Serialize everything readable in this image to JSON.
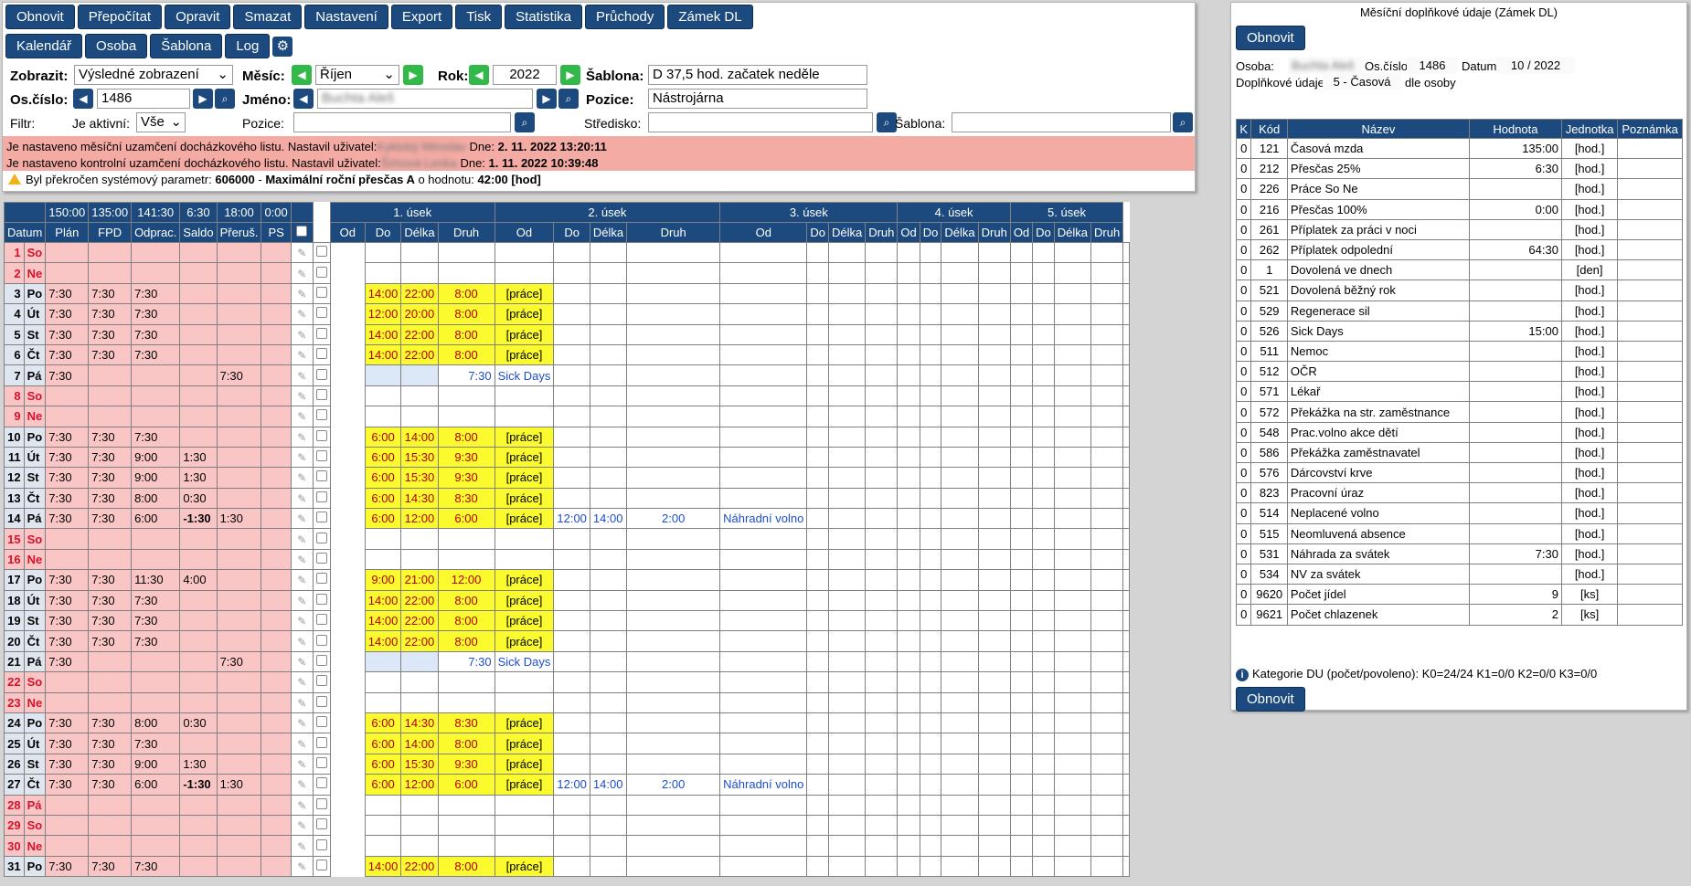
{
  "toolbar_row1": [
    "Obnovit",
    "Přepočítat",
    "Opravit",
    "Smazat",
    "Nastavení",
    "Export",
    "Tisk",
    "Statistika",
    "Průchody",
    "Zámek DL"
  ],
  "toolbar_row2": [
    "Kalendář",
    "Osoba",
    "Šablona",
    "Log"
  ],
  "filters": {
    "zobrazit_label": "Zobrazit:",
    "zobrazit_value": "Výsledné zobrazení",
    "mesic_label": "Měsíc:",
    "mesic_value": "Říjen",
    "rok_label": "Rok:",
    "rok_value": "2022",
    "sablona_label": "Šablona:",
    "sablona_value": "D 37,5 hod. začatek neděle",
    "oscislo_label": "Os.číslo:",
    "oscislo_value": "1486",
    "jmeno_label": "Jméno:",
    "jmeno_value": "Buchta Aleš",
    "pozice_label": "Pozice:",
    "pozice_value": "Nástrojárna",
    "filtr_label": "Filtr:",
    "aktivni_label": "Je aktivní:",
    "aktivni_value": "Vše",
    "pozice2_label": "Pozice:",
    "stredisko_label": "Středisko:",
    "sablona2_label": "Šablona:"
  },
  "messages": {
    "m1_a": "Je nastaveno měsíční uzamčení docházkového listu. Nastavil uživatel:",
    "m1_user": "Kyklobý Miroslav",
    "m1_b": " Dne: ",
    "m1_date": "2. 11. 2022 13:20:11",
    "m2_a": "Je nastaveno kontrolní uzamčení docházkového listu. Nastavil uživatel:",
    "m2_user": "Šímová Lenka",
    "m2_b": " Dne: ",
    "m2_date": "1. 11. 2022 10:39:48",
    "w_a": "Byl překročen systémový parametr: ",
    "w_code": "606000",
    "w_b": " - ",
    "w_name": "Maximální roční přesčas A",
    "w_c": " o hodnotu: ",
    "w_val": "42:00 [hod]"
  },
  "grid": {
    "totals": [
      "150:00",
      "135:00",
      "141:30",
      "6:30",
      "18:00",
      "0:00"
    ],
    "sections": [
      "1. úsek",
      "2. úsek",
      "3. úsek",
      "4. úsek",
      "5. úsek"
    ],
    "cols": [
      "Datum",
      "Plán",
      "FPD",
      "Odprac.",
      "Saldo",
      "Přeruš.",
      "PS"
    ],
    "sub": [
      "Od",
      "Do",
      "Délka",
      "Druh"
    ],
    "rows": [
      {
        "n": "1",
        "d": "So",
        "w": true
      },
      {
        "n": "2",
        "d": "Ne",
        "w": true,
        "sep": true
      },
      {
        "n": "3",
        "d": "Po",
        "plan": "7:30",
        "fpd": "7:30",
        "odp": "7:30",
        "od": "14:00",
        "do": "22:00",
        "del": "8:00",
        "druh": "[práce]"
      },
      {
        "n": "4",
        "d": "Út",
        "plan": "7:30",
        "fpd": "7:30",
        "odp": "7:30",
        "od": "12:00",
        "do": "20:00",
        "del": "8:00",
        "druh": "[práce]"
      },
      {
        "n": "5",
        "d": "St",
        "plan": "7:30",
        "fpd": "7:30",
        "odp": "7:30",
        "od": "14:00",
        "do": "22:00",
        "del": "8:00",
        "druh": "[práce]"
      },
      {
        "n": "6",
        "d": "Čt",
        "plan": "7:30",
        "fpd": "7:30",
        "odp": "7:30",
        "od": "14:00",
        "do": "22:00",
        "del": "8:00",
        "druh": "[práce]"
      },
      {
        "n": "7",
        "d": "Pá",
        "plan": "7:30",
        "per": "7:30",
        "sick": true,
        "del": "7:30",
        "druh": "Sick Days"
      },
      {
        "n": "8",
        "d": "So",
        "w": true
      },
      {
        "n": "9",
        "d": "Ne",
        "w": true,
        "sep": true
      },
      {
        "n": "10",
        "d": "Po",
        "plan": "7:30",
        "fpd": "7:30",
        "odp": "7:30",
        "od": "6:00",
        "do": "14:00",
        "del": "8:00",
        "druh": "[práce]"
      },
      {
        "n": "11",
        "d": "Út",
        "plan": "7:30",
        "fpd": "7:30",
        "odp": "9:00",
        "sal": "1:30",
        "od": "6:00",
        "do": "15:30",
        "del": "9:30",
        "druh": "[práce]"
      },
      {
        "n": "12",
        "d": "St",
        "plan": "7:30",
        "fpd": "7:30",
        "odp": "9:00",
        "sal": "1:30",
        "od": "6:00",
        "do": "15:30",
        "del": "9:30",
        "druh": "[práce]"
      },
      {
        "n": "13",
        "d": "Čt",
        "plan": "7:30",
        "fpd": "7:30",
        "odp": "8:00",
        "sal": "0:30",
        "od": "6:00",
        "do": "14:30",
        "del": "8:30",
        "druh": "[práce]"
      },
      {
        "n": "14",
        "d": "Pá",
        "plan": "7:30",
        "fpd": "7:30",
        "odp": "6:00",
        "sal": "-1:30",
        "per": "1:30",
        "od": "6:00",
        "do": "12:00",
        "del": "6:00",
        "druh": "[práce]",
        "od2": "12:00",
        "do2": "14:00",
        "del2": "2:00",
        "druh2": "Náhradní volno"
      },
      {
        "n": "15",
        "d": "So",
        "w": true
      },
      {
        "n": "16",
        "d": "Ne",
        "w": true,
        "sep": true
      },
      {
        "n": "17",
        "d": "Po",
        "plan": "7:30",
        "fpd": "7:30",
        "odp": "11:30",
        "sal": "4:00",
        "od": "9:00",
        "do": "21:00",
        "del": "12:00",
        "druh": "[práce]"
      },
      {
        "n": "18",
        "d": "Út",
        "plan": "7:30",
        "fpd": "7:30",
        "odp": "7:30",
        "od": "14:00",
        "do": "22:00",
        "del": "8:00",
        "druh": "[práce]"
      },
      {
        "n": "19",
        "d": "St",
        "plan": "7:30",
        "fpd": "7:30",
        "odp": "7:30",
        "od": "14:00",
        "do": "22:00",
        "del": "8:00",
        "druh": "[práce]"
      },
      {
        "n": "20",
        "d": "Čt",
        "plan": "7:30",
        "fpd": "7:30",
        "odp": "7:30",
        "od": "14:00",
        "do": "22:00",
        "del": "8:00",
        "druh": "[práce]"
      },
      {
        "n": "21",
        "d": "Pá",
        "plan": "7:30",
        "per": "7:30",
        "sick": true,
        "del": "7:30",
        "druh": "Sick Days"
      },
      {
        "n": "22",
        "d": "So",
        "w": true
      },
      {
        "n": "23",
        "d": "Ne",
        "w": true,
        "sep": true
      },
      {
        "n": "24",
        "d": "Po",
        "plan": "7:30",
        "fpd": "7:30",
        "odp": "8:00",
        "sal": "0:30",
        "od": "6:00",
        "do": "14:30",
        "del": "8:30",
        "druh": "[práce]"
      },
      {
        "n": "25",
        "d": "Út",
        "plan": "7:30",
        "fpd": "7:30",
        "odp": "7:30",
        "od": "6:00",
        "do": "14:00",
        "del": "8:00",
        "druh": "[práce]"
      },
      {
        "n": "26",
        "d": "St",
        "plan": "7:30",
        "fpd": "7:30",
        "odp": "9:00",
        "sal": "1:30",
        "od": "6:00",
        "do": "15:30",
        "del": "9:30",
        "druh": "[práce]"
      },
      {
        "n": "27",
        "d": "Čt",
        "plan": "7:30",
        "fpd": "7:30",
        "odp": "6:00",
        "sal": "-1:30",
        "per": "1:30",
        "od": "6:00",
        "do": "12:00",
        "del": "6:00",
        "druh": "[práce]",
        "od2": "12:00",
        "do2": "14:00",
        "del2": "2:00",
        "druh2": "Náhradní volno"
      },
      {
        "n": "28",
        "d": "Pá",
        "w": true
      },
      {
        "n": "29",
        "d": "So",
        "w": true
      },
      {
        "n": "30",
        "d": "Ne",
        "w": true,
        "sep": true
      },
      {
        "n": "31",
        "d": "Po",
        "plan": "7:30",
        "fpd": "7:30",
        "odp": "7:30",
        "od": "14:00",
        "do": "22:00",
        "del": "8:00",
        "druh": "[práce]"
      }
    ]
  },
  "right": {
    "title": "Měsíční doplňkové údaje (Zámek DL)",
    "obnovit": "Obnovit",
    "osoba_label": "Osoba:",
    "osoba_value": "Buchta Aleš",
    "oscislo_label": "Os.číslo:",
    "oscislo_value": "1486",
    "datum_label": "Datum:",
    "datum_value": "10 / 2022",
    "dopl_label": "Doplňkové údaje:",
    "dopl_value": "5 - Časová",
    "dopl_suffix": "dle osoby",
    "headers": [
      "K",
      "Kód",
      "Název",
      "Hodnota",
      "Jednotka",
      "Poznámka"
    ],
    "rows": [
      [
        "0",
        "121",
        "Časová mzda",
        "135:00",
        "[hod.]"
      ],
      [
        "0",
        "212",
        "Přesčas 25%",
        "6:30",
        "[hod.]"
      ],
      [
        "0",
        "226",
        "Práce So Ne",
        "",
        "[hod.]"
      ],
      [
        "0",
        "216",
        "Přesčas 100%",
        "0:00",
        "[hod.]"
      ],
      [
        "0",
        "261",
        "Příplatek za práci v noci",
        "",
        "[hod.]"
      ],
      [
        "0",
        "262",
        "Příplatek odpolední",
        "64:30",
        "[hod.]"
      ],
      [
        "0",
        "1",
        "Dovolená ve dnech",
        "",
        "[den]"
      ],
      [
        "0",
        "521",
        "Dovolená běžný rok",
        "",
        "[hod.]"
      ],
      [
        "0",
        "529",
        "Regenerace sil",
        "",
        "[hod.]"
      ],
      [
        "0",
        "526",
        "Sick Days",
        "15:00",
        "[hod.]"
      ],
      [
        "0",
        "511",
        "Nemoc",
        "",
        "[hod.]"
      ],
      [
        "0",
        "512",
        "OČR",
        "",
        "[hod.]"
      ],
      [
        "0",
        "571",
        "Lékař",
        "",
        "[hod.]"
      ],
      [
        "0",
        "572",
        "Překážka na str. zaměstnance",
        "",
        "[hod.]"
      ],
      [
        "0",
        "548",
        "Prac.volno akce dětí",
        "",
        "[hod.]"
      ],
      [
        "0",
        "586",
        "Překážka zaměstnavatel",
        "",
        "[hod.]"
      ],
      [
        "0",
        "576",
        "Dárcovství krve",
        "",
        "[hod.]"
      ],
      [
        "0",
        "823",
        "Pracovní úraz",
        "",
        "[hod.]"
      ],
      [
        "0",
        "514",
        "Neplacené volno",
        "",
        "[hod.]"
      ],
      [
        "0",
        "515",
        "Neomluvená absence",
        "",
        "[hod.]"
      ],
      [
        "0",
        "531",
        "Náhrada za svátek",
        "7:30",
        "[hod.]"
      ],
      [
        "0",
        "534",
        "NV za svátek",
        "",
        "[hod.]"
      ],
      [
        "0",
        "9620",
        "Počet jídel",
        "9",
        "[ks]"
      ],
      [
        "0",
        "9621",
        "Počet chlazenek",
        "2",
        "[ks]"
      ]
    ],
    "kategorie": "Kategorie DU (počet/povoleno): K0=24/24 K1=0/0 K2=0/0 K3=0/0",
    "obnovit2": "Obnovit"
  }
}
